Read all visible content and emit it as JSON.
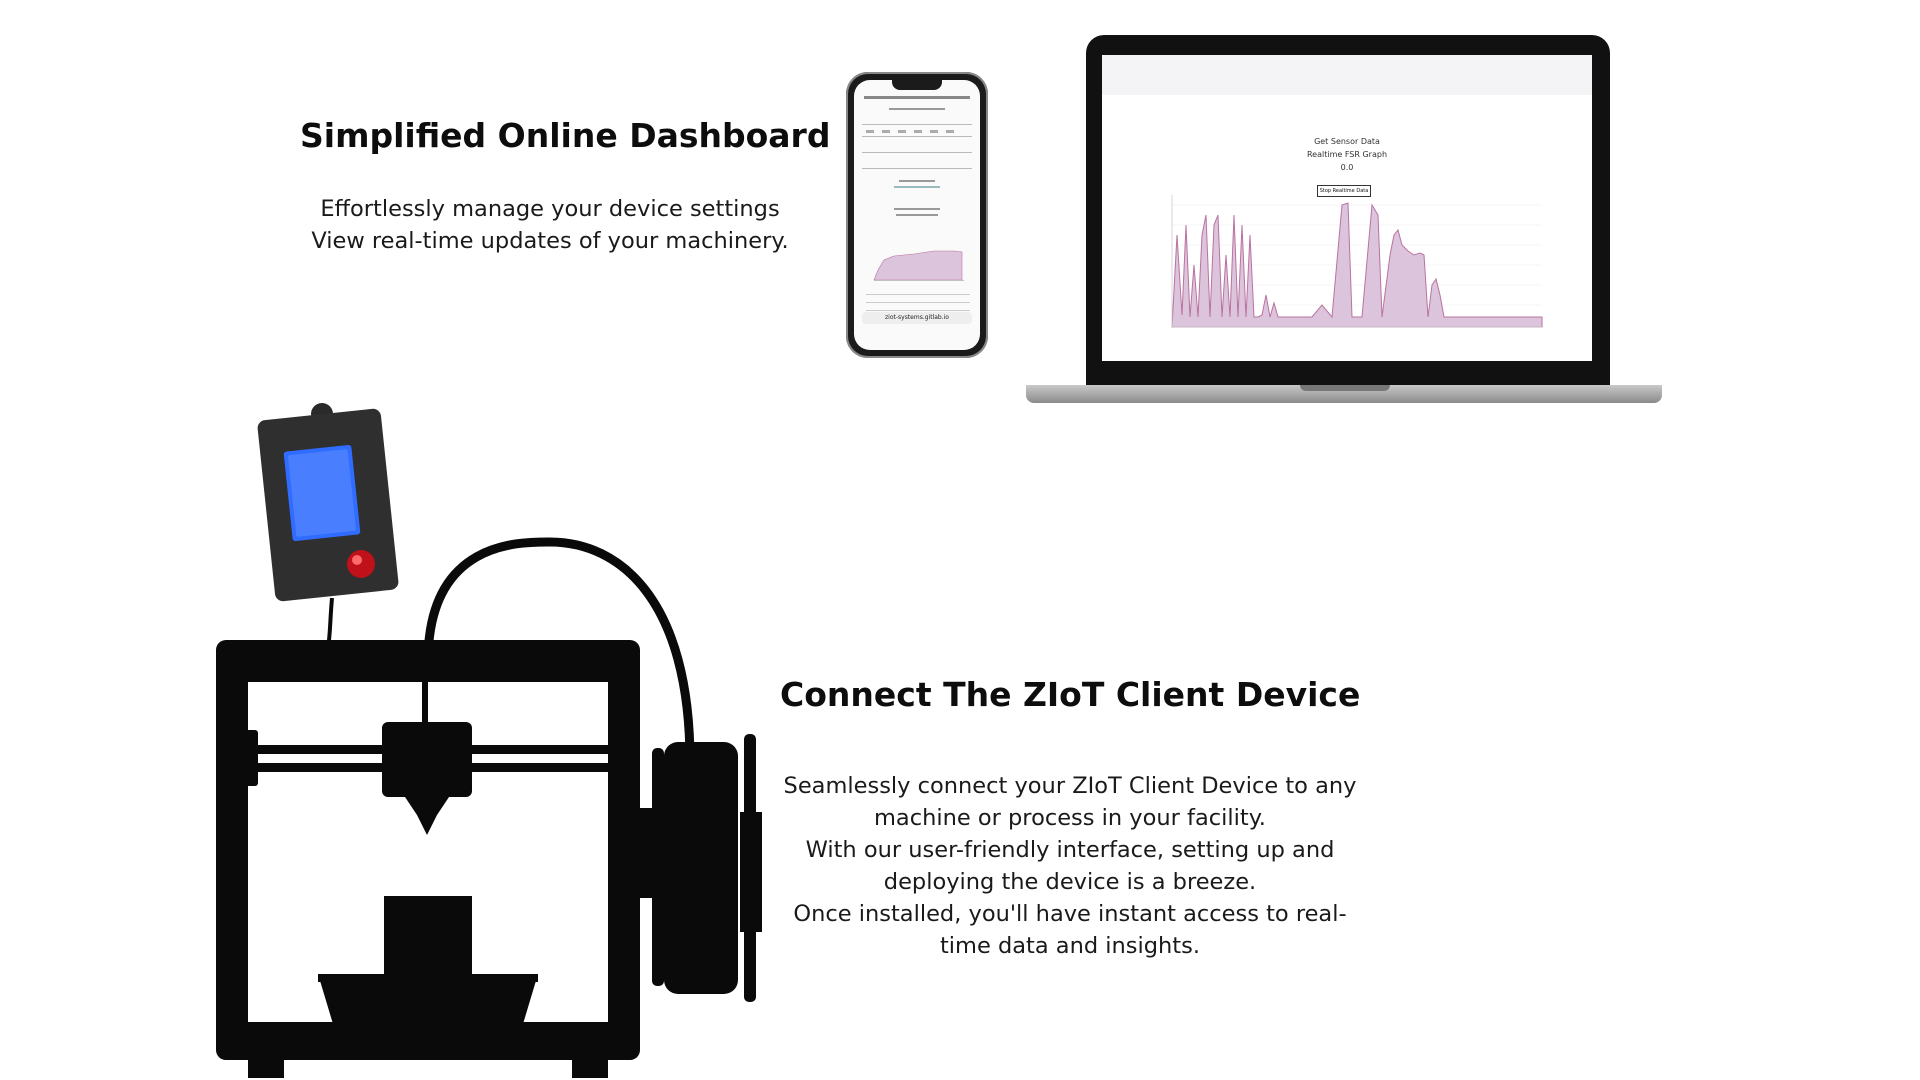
{
  "dashboard": {
    "title": "Simplified Online Dashboard",
    "lines": [
      "Effortlessly manage your device settings",
      "View real-time updates of your machinery."
    ]
  },
  "client": {
    "title": "Connect The ZIoT Client Device",
    "lines": [
      "Seamlessly connect your ZIoT Client Device to any",
      "machine or process in your facility.",
      "With our user-friendly interface, setting up and",
      "deploying the device is a breeze.",
      "Once installed, you'll have instant access to real-",
      "time data and insights."
    ]
  },
  "phone": {
    "url": "ziot-systems.gitlab.io"
  },
  "laptop": {
    "graph_heading": "Get Sensor Data",
    "graph_subheading": "Realtime FSR Graph",
    "graph_value": "0.0",
    "graph_button": "Stop Realtime Data"
  },
  "colors": {
    "chart_fill": "#dcc4dc",
    "chart_line": "#b9739f",
    "lcd_blue": "#2f6cff",
    "printer_black": "#0a0a0a"
  }
}
